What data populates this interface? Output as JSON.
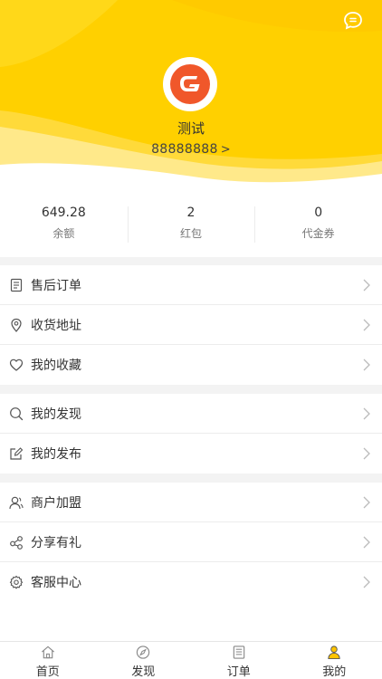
{
  "colors": {
    "brand": "#FFD000",
    "brand_light": "#FFE680",
    "logo": "#F0572A",
    "active_tab": "#FFB800"
  },
  "profile": {
    "name": "测试",
    "account": "88888888",
    "chevron": ">"
  },
  "stats": [
    {
      "value": "649.28",
      "label": "余额"
    },
    {
      "value": "2",
      "label": "红包"
    },
    {
      "value": "0",
      "label": "代金券"
    }
  ],
  "menu": {
    "group1": [
      {
        "label": "售后订单",
        "icon": "after-sales-icon"
      },
      {
        "label": "收货地址",
        "icon": "location-icon"
      },
      {
        "label": "我的收藏",
        "icon": "heart-icon"
      }
    ],
    "group2": [
      {
        "label": "我的发现",
        "icon": "search-icon"
      },
      {
        "label": "我的发布",
        "icon": "edit-icon"
      }
    ],
    "group3": [
      {
        "label": "商户加盟",
        "icon": "merchant-icon"
      },
      {
        "label": "分享有礼",
        "icon": "share-icon"
      },
      {
        "label": "客服中心",
        "icon": "settings-icon"
      }
    ]
  },
  "tabs": [
    {
      "label": "首页",
      "icon": "home-icon"
    },
    {
      "label": "发现",
      "icon": "compass-icon"
    },
    {
      "label": "订单",
      "icon": "order-icon"
    },
    {
      "label": "我的",
      "icon": "user-icon",
      "active": true
    }
  ]
}
